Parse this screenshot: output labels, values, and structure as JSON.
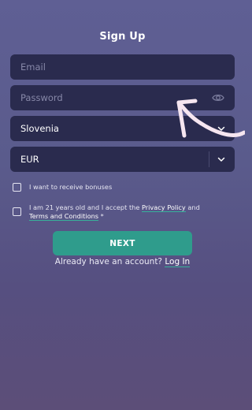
{
  "form": {
    "title": "Sign Up",
    "email_placeholder": "Email",
    "password_placeholder": "Password",
    "country_value": "Slovenia",
    "currency_value": "EUR",
    "bonus_label": "I want to receive bonuses",
    "terms_prefix": "I am 21 years old and I accept the ",
    "privacy_link": "Privacy Policy",
    "terms_middle": " and",
    "terms_link": "Terms and Conditions",
    "terms_required": " *",
    "next_label": "NEXT",
    "login_prompt": "Already have an account? ",
    "login_link": "Log In"
  },
  "icons": {
    "password_toggle": "eye-icon",
    "country_dropdown": "chevron-down-icon",
    "currency_dropdown": "chevron-down-icon",
    "annotation": "hand-drawn-arrow"
  },
  "colors": {
    "field_bg": "#2a2b4e",
    "accent": "#2f9c8c",
    "link_underline": "#37b29a",
    "arrow": "#f6e6f0"
  }
}
